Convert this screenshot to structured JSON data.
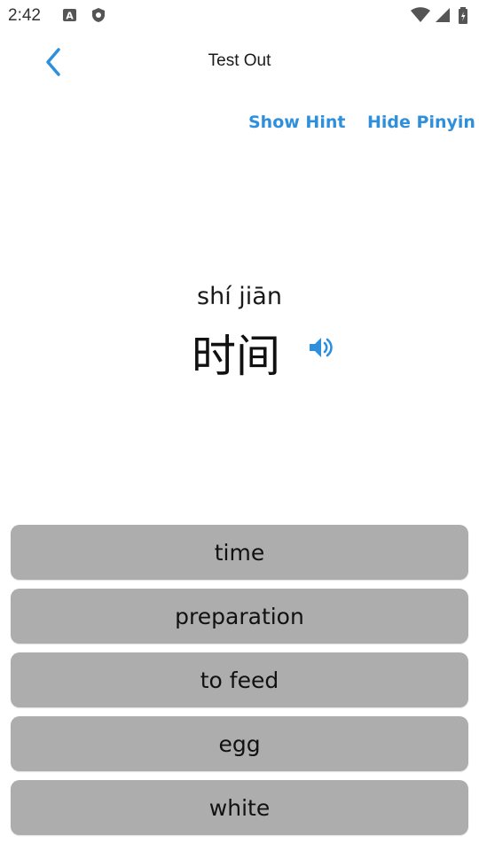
{
  "status_bar": {
    "time": "2:42",
    "icons": [
      "a-icon",
      "shield-icon",
      "wifi-icon",
      "signal-icon",
      "battery-icon"
    ]
  },
  "app_bar": {
    "title": "Test Out",
    "back_icon": "chevron-left-icon"
  },
  "actions": {
    "show_hint": "Show Hint",
    "hide_pinyin": "Hide Pinyin"
  },
  "word": {
    "pinyin": "shí jiān",
    "hanzi": "时间",
    "speaker_icon": "speaker-icon"
  },
  "answers": [
    "time",
    "preparation",
    "to feed",
    "egg",
    "white"
  ],
  "colors": {
    "accent": "#2e90dc",
    "answer_bg": "#adadad",
    "background": "#ffffff"
  }
}
